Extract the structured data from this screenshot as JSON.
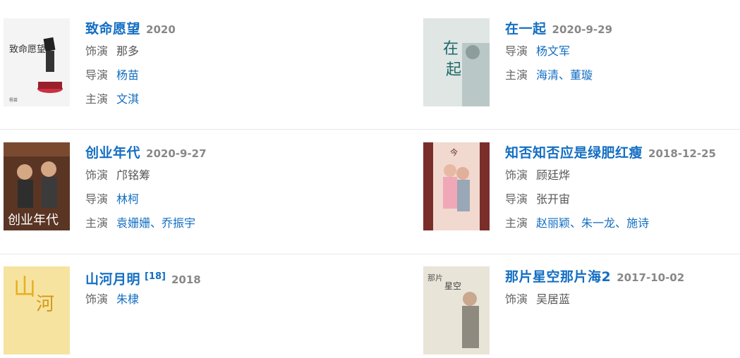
{
  "items": [
    {
      "title": "致命愿望",
      "year": "2020",
      "rows": [
        {
          "label": "饰演",
          "values": [
            "那多"
          ],
          "linked": false
        },
        {
          "label": "导演",
          "values": [
            "杨苗"
          ],
          "linked": true
        },
        {
          "label": "主演",
          "values": [
            "文淇"
          ],
          "linked": true
        }
      ],
      "poster_text": "致命愿望"
    },
    {
      "title": "在一起",
      "year": "2020-9-29",
      "rows": [
        {
          "label": "导演",
          "values": [
            "杨文军"
          ],
          "linked": true
        },
        {
          "label": "主演",
          "values": [
            "海清",
            "董璇"
          ],
          "linked": true
        }
      ],
      "poster_text": "在一起"
    },
    {
      "title": "创业年代",
      "year": "2020-9-27",
      "rows": [
        {
          "label": "饰演",
          "values": [
            "邝铭筹"
          ],
          "linked": false
        },
        {
          "label": "导演",
          "values": [
            "林柯"
          ],
          "linked": true
        },
        {
          "label": "主演",
          "values": [
            "袁姗姗",
            "乔振宇"
          ],
          "linked": true
        }
      ],
      "poster_text": "创业年代"
    },
    {
      "title": "知否知否应是绿肥红瘦",
      "year": "2018-12-25",
      "rows": [
        {
          "label": "饰演",
          "values": [
            "顾廷烨"
          ],
          "linked": false
        },
        {
          "label": "导演",
          "values": [
            "张开宙"
          ],
          "linked": false
        },
        {
          "label": "主演",
          "values": [
            "赵丽颖",
            "朱一龙",
            "施诗"
          ],
          "linked": true
        }
      ],
      "poster_text": "知否"
    },
    {
      "title": "山河月明",
      "ref": "[18]",
      "year": "2018",
      "rows": [
        {
          "label": "饰演",
          "values": [
            "朱棣"
          ],
          "linked": true
        }
      ],
      "poster_text": "山河"
    },
    {
      "title": "那片星空那片海2",
      "year": "2017-10-02",
      "rows": [
        {
          "label": "饰演",
          "values": [
            "吴居蓝"
          ],
          "linked": false
        }
      ],
      "poster_text": "那片星空"
    }
  ]
}
